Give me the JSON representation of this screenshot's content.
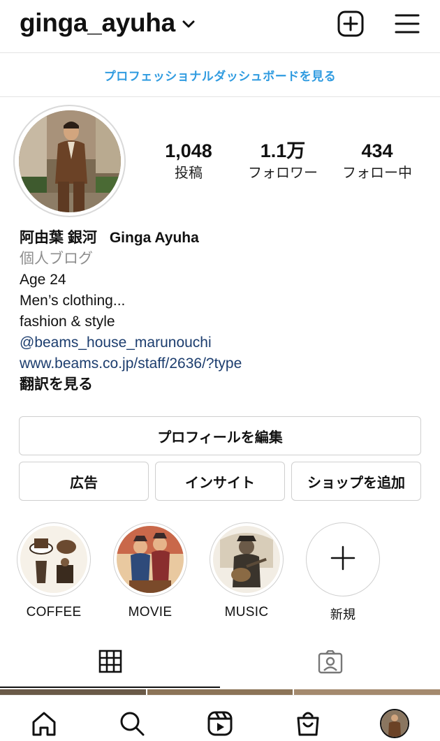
{
  "header": {
    "username": "ginga_ayuha",
    "icons": [
      "chevron-down-icon",
      "plus-square-icon",
      "hamburger-menu-icon"
    ]
  },
  "dashboard": {
    "label": "プロフェッショナルダッシュボードを見る"
  },
  "stats": {
    "posts": {
      "value": "1,048",
      "label": "投稿"
    },
    "followers": {
      "value": "1.1万",
      "label": "フォロワー"
    },
    "following": {
      "value": "434",
      "label": "フォロー中"
    }
  },
  "bio": {
    "name_jp": "阿由葉 銀河",
    "name_en": "Ginga Ayuha",
    "category": "個人ブログ",
    "lines": [
      "Age 24",
      "Men’s clothing...",
      "fashion & style"
    ],
    "mention": "@beams_house_marunouchi",
    "website": "www.beams.co.jp/staff/2636/?type",
    "translate": "翻訳を見る"
  },
  "buttons": {
    "edit_profile": "プロフィールを編集",
    "ads": "広告",
    "insights": "インサイト",
    "add_shop": "ショップを追加"
  },
  "highlights": [
    {
      "label": "COFFEE"
    },
    {
      "label": "MOVIE"
    },
    {
      "label": "MUSIC"
    },
    {
      "label": "新規"
    }
  ],
  "tabs": [
    "grid-icon",
    "tagged-icon"
  ],
  "nav": [
    "home-icon",
    "search-icon",
    "reels-icon",
    "shop-icon",
    "profile-avatar"
  ],
  "colors": {
    "link_blue": "#2f9be0",
    "bio_link": "#1c3d6e",
    "muted": "#8e8e8e",
    "border": "#cfcfcf"
  }
}
